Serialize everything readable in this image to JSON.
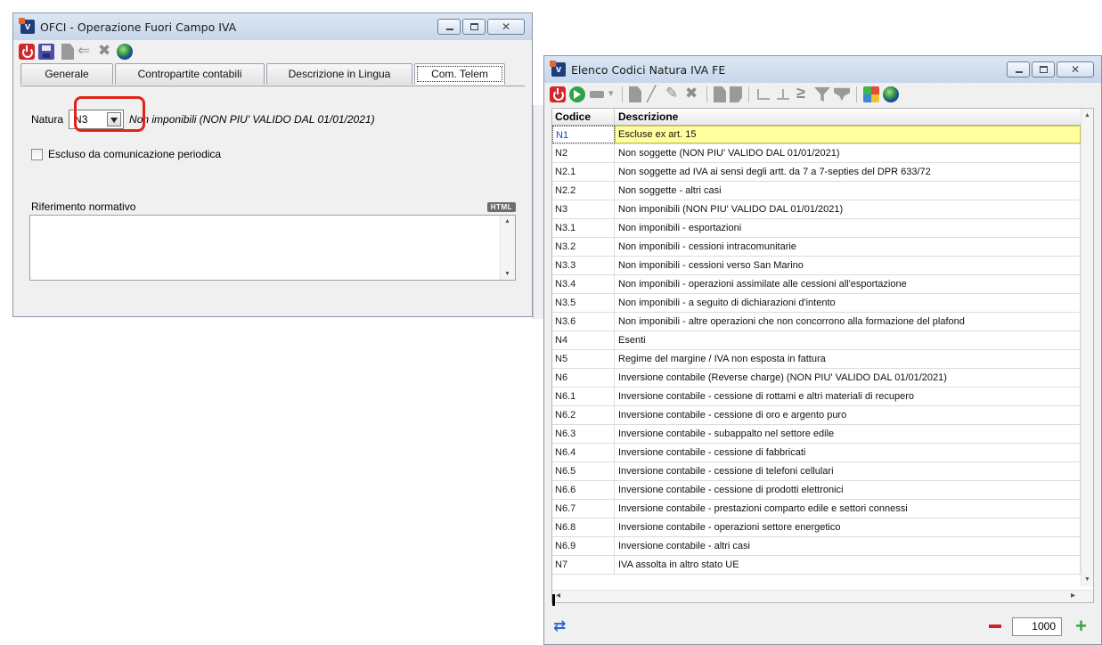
{
  "window_ofci": {
    "title": "OFCI - Operazione Fuori Campo IVA",
    "toolbar_icons": [
      "power-icon",
      "save-icon",
      "document-icon",
      "back-arrow-icon",
      "delete-icon",
      "globe-icon"
    ],
    "tabs": [
      {
        "label": "Generale",
        "active": false
      },
      {
        "label": "Contropartite contabili",
        "active": false
      },
      {
        "label": "Descrizione in Lingua",
        "active": false
      },
      {
        "label": "Com. Telem",
        "active": true
      }
    ],
    "natura_label": "Natura",
    "natura_value": "N3",
    "natura_description": "Non imponibili (NON PIU' VALIDO DAL 01/01/2021)",
    "checkbox_label": "Escluso da comunicazione periodica",
    "checkbox_checked": false,
    "riferimento_label": "Riferimento normativo",
    "html_badge": "HTML",
    "riferimento_value": ""
  },
  "window_elenco": {
    "title": "Elenco Codici Natura IVA FE",
    "columns": {
      "code": "Codice",
      "description": "Descrizione"
    },
    "rows": [
      {
        "code": "N1",
        "description": "Escluse ex art. 15",
        "selected": true
      },
      {
        "code": "N2",
        "description": "Non soggette (NON PIU' VALIDO DAL 01/01/2021)"
      },
      {
        "code": "N2.1",
        "description": "Non soggette ad IVA ai sensi degli artt. da 7 a 7-septies del DPR 633/72"
      },
      {
        "code": "N2.2",
        "description": "Non soggette - altri casi"
      },
      {
        "code": "N3",
        "description": "Non imponibili (NON PIU' VALIDO DAL 01/01/2021)"
      },
      {
        "code": "N3.1",
        "description": "Non imponibili - esportazioni"
      },
      {
        "code": "N3.2",
        "description": "Non imponibili - cessioni intracomunitarie"
      },
      {
        "code": "N3.3",
        "description": "Non imponibili - cessioni verso San Marino"
      },
      {
        "code": "N3.4",
        "description": "Non imponibili - operazioni assimilate alle cessioni all'esportazione"
      },
      {
        "code": "N3.5",
        "description": "Non imponibili - a seguito di dichiarazioni d'intento"
      },
      {
        "code": "N3.6",
        "description": "Non imponibili - altre operazioni che non concorrono alla formazione del plafond"
      },
      {
        "code": "N4",
        "description": "Esenti"
      },
      {
        "code": "N5",
        "description": "Regime del margine / IVA non esposta in fattura"
      },
      {
        "code": "N6",
        "description": "Inversione contabile (Reverse charge) (NON PIU' VALIDO DAL 01/01/2021)"
      },
      {
        "code": "N6.1",
        "description": "Inversione contabile - cessione di rottami e altri materiali di recupero"
      },
      {
        "code": "N6.2",
        "description": "Inversione contabile - cessione di oro e argento puro"
      },
      {
        "code": "N6.3",
        "description": "Inversione contabile - subappalto nel settore edile"
      },
      {
        "code": "N6.4",
        "description": "Inversione contabile - cessione di fabbricati"
      },
      {
        "code": "N6.5",
        "description": "Inversione contabile - cessione di telefoni cellulari"
      },
      {
        "code": "N6.6",
        "description": "Inversione contabile - cessione di prodotti elettronici"
      },
      {
        "code": "N6.7",
        "description": "Inversione contabile - prestazioni comparto edile e settori connessi"
      },
      {
        "code": "N6.8",
        "description": "Inversione contabile - operazioni settore energetico"
      },
      {
        "code": "N6.9",
        "description": "Inversione contabile - altri casi"
      },
      {
        "code": "N7",
        "description": "IVA assolta in altro stato UE"
      }
    ],
    "row_limit": "1000"
  },
  "colors": {
    "selection": "#ffffa0",
    "highlight_box": "#e0241a",
    "minus": "#d21f2a",
    "plus": "#3aa33d"
  }
}
